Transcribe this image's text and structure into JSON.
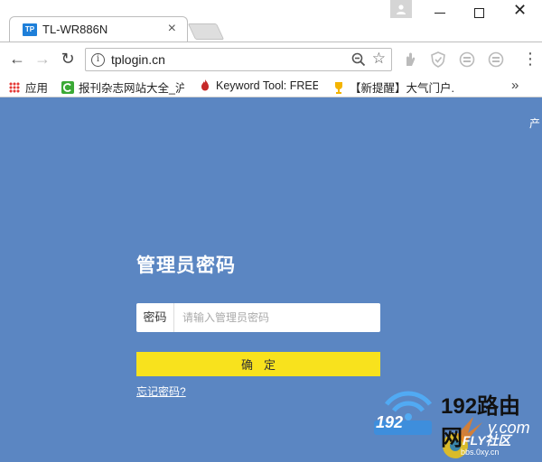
{
  "tab": {
    "title": "TL-WR886N",
    "favicon_text": "TP"
  },
  "toolbar": {
    "url": "tplogin.cn"
  },
  "bookmarks": {
    "apps_label": "应用",
    "items": [
      {
        "label": "报刊杂志网站大全_沪"
      },
      {
        "label": "Keyword Tool: FREE"
      },
      {
        "label": "【新提醒】大气门户."
      }
    ],
    "more": "»"
  },
  "page": {
    "corner_text": "产",
    "title": "管理员密码",
    "password_label": "密码",
    "password_placeholder": "请输入管理员密码",
    "confirm_label": "确定",
    "forgot_label": "忘记密码?"
  },
  "watermark": {
    "title": "192路由网",
    "number": "192",
    "fly": "FLY社区",
    "url": "bbs.0xy.cn",
    "partial": "y.com"
  },
  "colors": {
    "page_bg": "#5b86c2",
    "button_bg": "#f8e21d",
    "brand_blue": "#1e7fd9"
  }
}
